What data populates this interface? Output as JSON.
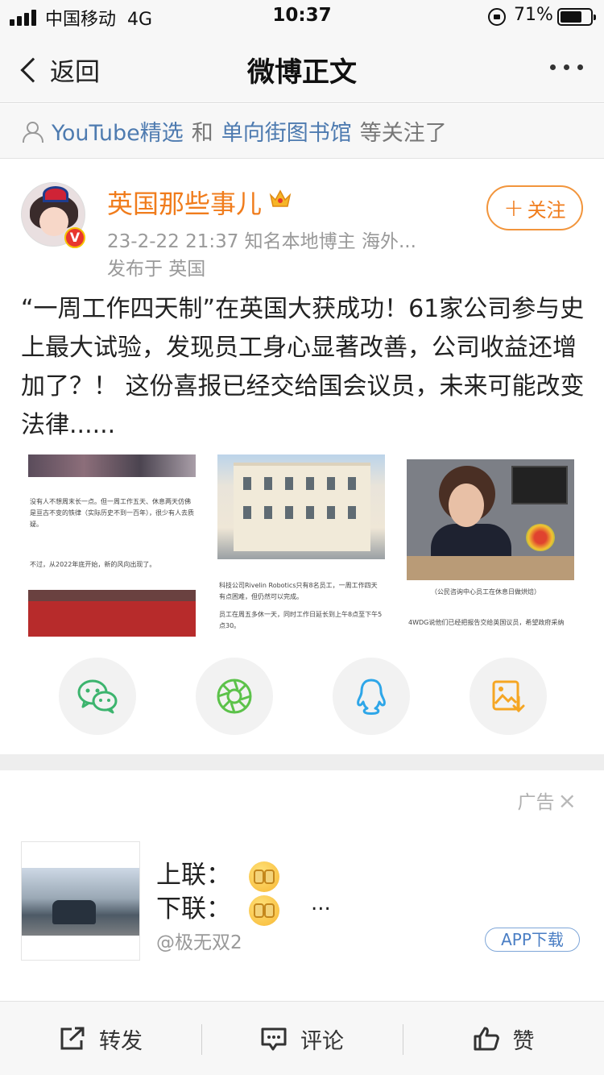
{
  "status_bar": {
    "carrier": "中国移动",
    "network": "4G",
    "time": "10:37",
    "battery": "71%",
    "battery_level": 0.71
  },
  "nav": {
    "back_label": "返回",
    "title": "微博正文",
    "more_icon": "ellipsis-icon"
  },
  "followers": {
    "user1": "YouTube精选",
    "conjunction": "和",
    "user2": "单向街图书馆",
    "suffix": "等关注了"
  },
  "author": {
    "name": "英国那些事儿",
    "badge_icon": "crown-icon",
    "verified_mark": "V",
    "meta": "23-2-22 21:37  知名本地博主 海外...",
    "location": "发布于 英国",
    "follow_label": "关注",
    "follow_plus": "+"
  },
  "post": {
    "text": "“一周工作四天制”在英国大获成功！61家公司参与史上最大试验，发现员工身心显著改善，公司收益还增加了？！ 这份喜报已经交给国会议员，未来可能改变法律......",
    "images": [
      {
        "text1": "没有人不想周末长一点。但一周工作五天、休息两天仿佛是亘古不变的铁律（实际历史不到一百年），很少有人去质疑。",
        "text2": "不过，从2022年底开始，新的风向出现了。"
      },
      {
        "text1": "科技公司Rivelin Robotics只有8名员工，一周工作四天有点困难，但仍然可以完成。",
        "text2": "员工在周五多休一天，同时工作日延长到上午8点至下午5点30。"
      },
      {
        "caption": "（公民咨询中心员工在休息日做烘焙）",
        "text2": "4WDG说他们已经把报告交给英国议员，希望政府采纳"
      }
    ]
  },
  "share": [
    {
      "icon": "wechat-icon",
      "color": "#3cb46e"
    },
    {
      "icon": "moments-icon",
      "color": "#5cc24a"
    },
    {
      "icon": "qq-icon",
      "color": "#2ea6e8"
    },
    {
      "icon": "save-image-icon",
      "color": "#f5a623"
    }
  ],
  "ad": {
    "label": "广告",
    "close_icon": "close-icon",
    "line1": "上联：",
    "line2": "下联：",
    "ellipsis": "...",
    "source": "@极无双2",
    "download_label": "APP下载"
  },
  "bottom_bar": {
    "repost": "转发",
    "comment": "评论",
    "like": "赞"
  }
}
